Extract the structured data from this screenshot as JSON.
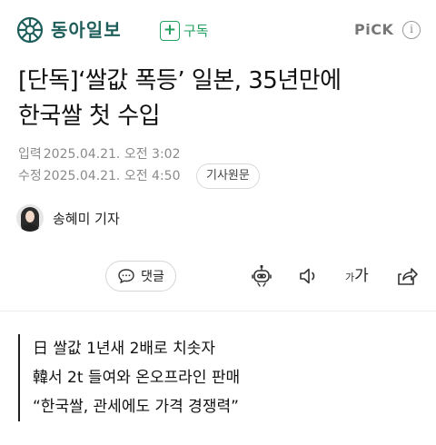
{
  "header": {
    "brand_name": "동아일보",
    "subscribe_label": "구독",
    "pick_label": "PiCK",
    "info_icon_glyph": "i",
    "brand_color": "#1f5e5a",
    "accent_color": "#21a05f"
  },
  "article": {
    "headline_line1": "[단독]‘쌀값 폭등’ 일본, 35년만에",
    "headline_line2": "한국쌀 첫 수입",
    "input_label": "입력",
    "input_time": "2025.04.21. 오전 3:02",
    "modified_label": "수정",
    "modified_time": "2025.04.21. 오전 4:50",
    "original_button": "기사원문",
    "author": "송혜미 기자"
  },
  "toolbar": {
    "comment_label": "댓글",
    "font_small": "가",
    "font_big": "가",
    "icons": [
      "comment-icon",
      "robot-summary-icon",
      "speaker-icon",
      "font-size-icon",
      "share-icon"
    ]
  },
  "summary": {
    "lines": [
      "日 쌀값 1년새 2배로 치솟자",
      "韓서 2t 들여와 온오프라인 판매",
      "“한국쌀, 관세에도 가격 경쟁력”"
    ]
  }
}
